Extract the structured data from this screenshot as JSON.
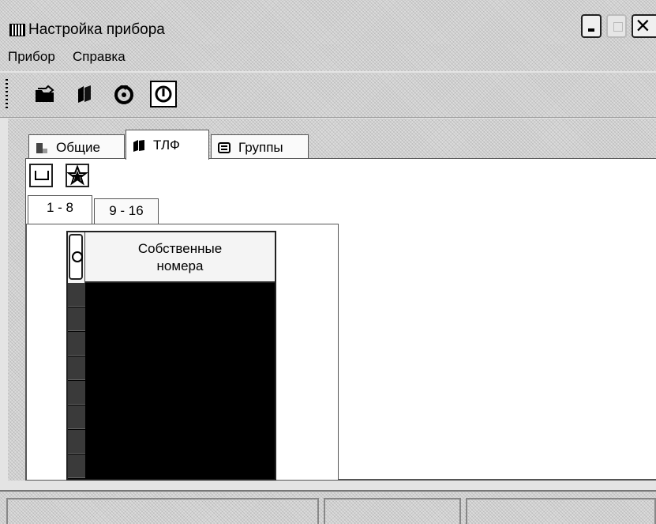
{
  "window": {
    "title": "Настройка прибора",
    "icon": "app-icon"
  },
  "menu": {
    "items": [
      "Прибор",
      "Справка"
    ]
  },
  "toolbar": {
    "buttons": [
      "open-folder-icon",
      "book-icon",
      "connect-icon",
      "power-icon"
    ]
  },
  "tabs": [
    {
      "label": "Общие",
      "icon": "general-icon"
    },
    {
      "label": "ТЛФ",
      "icon": "phonebook-icon",
      "active": true
    },
    {
      "label": "Группы",
      "icon": "groups-icon"
    }
  ],
  "tlf": {
    "buttons": [
      "edit-icon",
      "star-icon"
    ],
    "subtabs": [
      {
        "label": "1 - 8",
        "active": true
      },
      {
        "label": "9 - 16"
      }
    ],
    "grid": {
      "header": "Собственные номера",
      "rows": 8
    }
  },
  "statusbar": {
    "cells": [
      "",
      "",
      ""
    ]
  }
}
